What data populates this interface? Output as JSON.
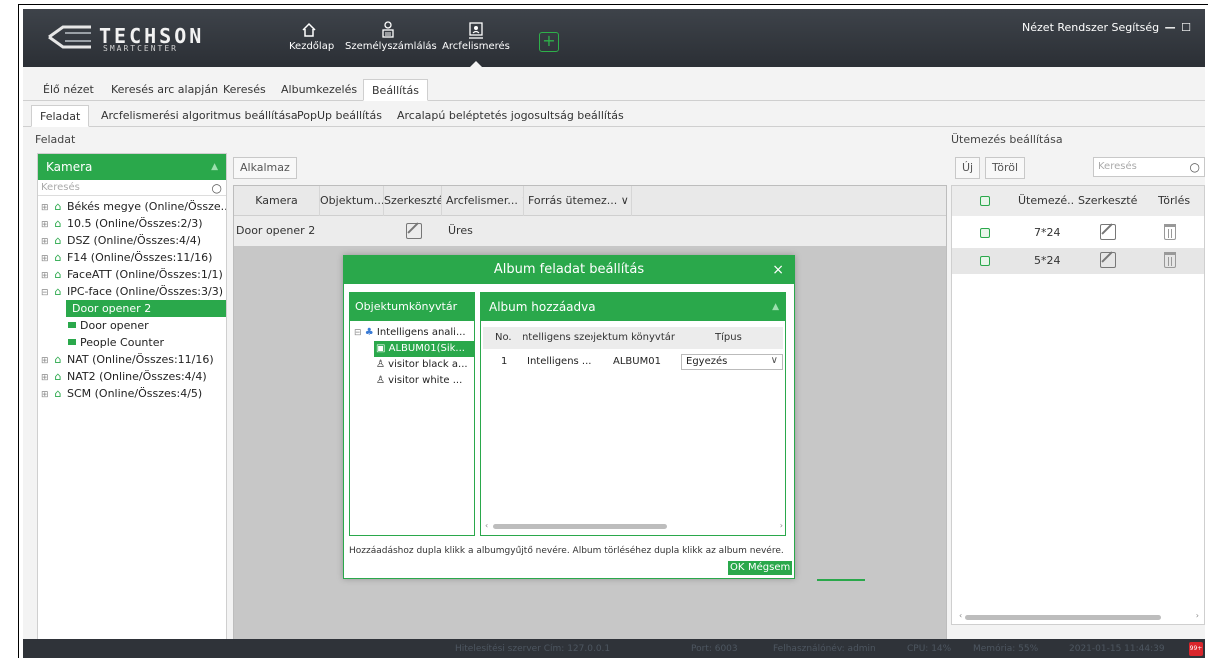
{
  "header": {
    "brand": "TECHSON",
    "brand_sub": "SMARTCENTER",
    "nav": [
      {
        "label": "Kezdőlap",
        "icon": "home-icon"
      },
      {
        "label": "Személyszámlálás",
        "icon": "people-counting-icon"
      },
      {
        "label": "Arcfelismerés",
        "icon": "face-recognition-icon"
      }
    ],
    "menu_text": "Nézet Rendszer Segítség",
    "minimize": "—",
    "maximize": "☐"
  },
  "tabs_main": [
    "Élő nézet",
    "Keresés arc alapján",
    "Keresés",
    "Albumkezelés",
    "Beállítás"
  ],
  "tabs_sub": [
    "Feladat",
    "Arcfelismerési algoritmus beállítása",
    "PopUp beállítás",
    "Arcalapú beléptetés jogosultság beállítás"
  ],
  "task_label": "Feladat",
  "schedule_label": "Ütemezés beállítása",
  "camera_panel": {
    "title": "Kamera",
    "search_placeholder": "Keresés",
    "tree": [
      {
        "label": "Békés megye (Online/Össze...",
        "type": "group"
      },
      {
        "label": "10.5 (Online/Összes:2/3)",
        "type": "group"
      },
      {
        "label": "DSZ (Online/Összes:4/4)",
        "type": "group"
      },
      {
        "label": "F14 (Online/Összes:11/16)",
        "type": "group"
      },
      {
        "label": "FaceATT (Online/Összes:1/1)",
        "type": "group"
      },
      {
        "label": "IPC-face (Online/Összes:3/3)",
        "type": "group-open"
      },
      {
        "label": "Door opener 2",
        "type": "camera-selected"
      },
      {
        "label": "Door opener",
        "type": "camera"
      },
      {
        "label": "People Counter",
        "type": "camera"
      },
      {
        "label": "NAT (Online/Összes:11/16)",
        "type": "group"
      },
      {
        "label": "NAT2 (Online/Összes:4/4)",
        "type": "group"
      },
      {
        "label": "SCM (Online/Összes:4/5)",
        "type": "group"
      }
    ]
  },
  "task_grid": {
    "apply_button": "Alkalmaz",
    "columns": [
      "Kamera",
      "Objektum...",
      "Szerkesztés",
      "Arcfelismer...",
      "Forrás ütemez..."
    ],
    "rows": [
      {
        "camera": "Door opener 2",
        "status": "Üres"
      }
    ]
  },
  "dialog": {
    "title": "Album feladat beállítás",
    "close": "×",
    "object_panel_title": "Objektumkönyvtár",
    "object_tree": [
      "Intelligens anali...",
      "ALBUM01(Sik...",
      "visitor black a...",
      "visitor white ..."
    ],
    "album_panel_title": "Album hozzáadva",
    "album_columns": [
      "No.",
      "Intelligens szerver",
      "Objektum könyvtár",
      "Típus"
    ],
    "album_rows": [
      {
        "no": "1",
        "server": "Intelligens ...",
        "library": "ALBUM01",
        "type": "Egyezés"
      }
    ],
    "hint": "Hozzáadáshoz dupla klikk a albumgyűjtő nevére. Album törléséhez dupla klikk az album nevére.",
    "ok": "OK",
    "cancel": "Mégsem"
  },
  "schedule": {
    "new_button": "Új",
    "delete_button": "Töröl",
    "search_placeholder": "Keresés",
    "columns": [
      "Ütemezé...",
      "Szerkesztés",
      "Törlés"
    ],
    "rows": [
      {
        "schedule": "7*24"
      },
      {
        "schedule": "5*24"
      }
    ]
  },
  "statusbar": {
    "auth_server": "Hitelesítési szerver Cím: 127.0.0.1",
    "port": "Port: 6003",
    "user": "Felhasználónév: admin",
    "cpu": "CPU: 14%",
    "memory": "Memória: 55%",
    "datetime": "2021-01-15 11:44:39",
    "notifications": "99+"
  },
  "colors": {
    "accent": "#2aa84b",
    "header_bg": "#2b2f35",
    "dimmed": "#c7c7c7"
  }
}
